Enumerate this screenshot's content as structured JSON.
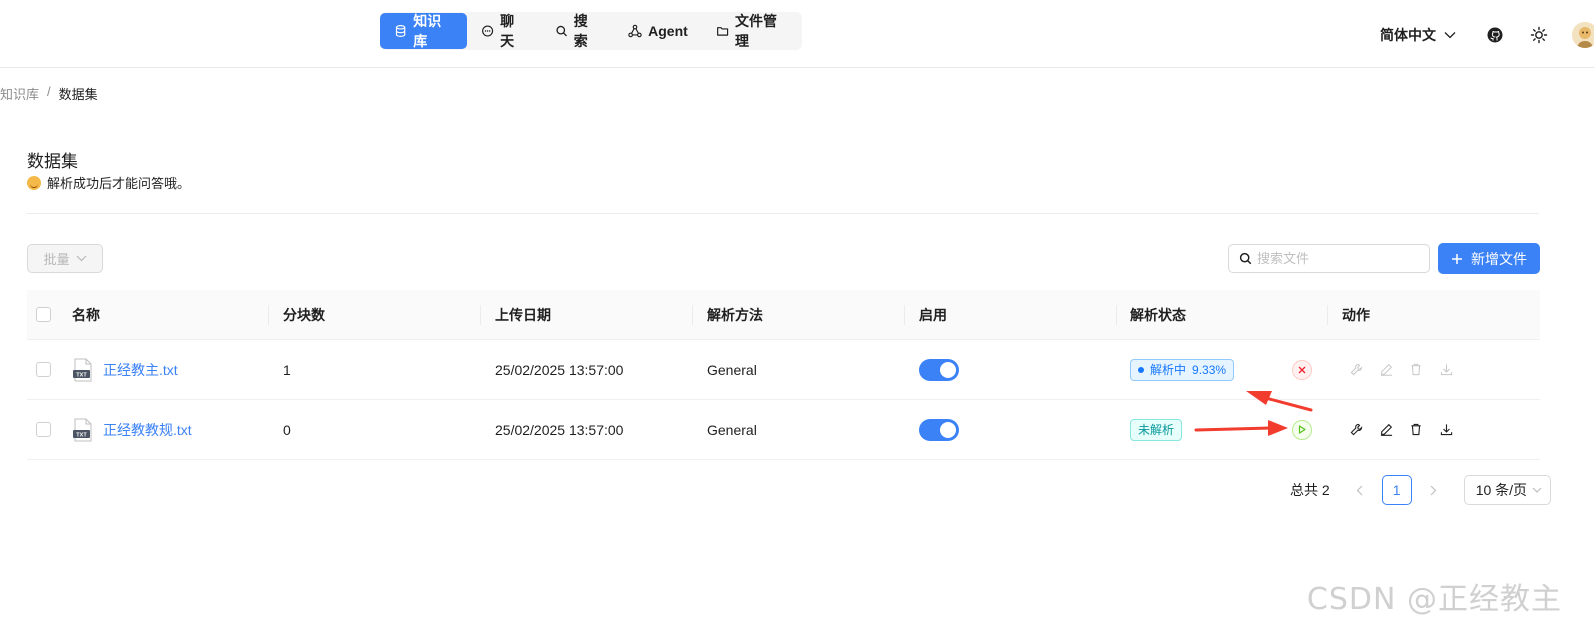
{
  "nav": {
    "items": [
      {
        "label": "知识库",
        "icon": "database-icon",
        "active": true
      },
      {
        "label": "聊天",
        "icon": "chat-icon"
      },
      {
        "label": "搜索",
        "icon": "search-icon"
      },
      {
        "label": "Agent",
        "icon": "agent-icon"
      },
      {
        "label": "文件管理",
        "icon": "folder-icon"
      }
    ],
    "language": "简体中文"
  },
  "breadcrumb": {
    "parent": "知识库",
    "separator": "/",
    "current": "数据集"
  },
  "page": {
    "title": "数据集",
    "subtitle": "解析成功后才能问答哦。"
  },
  "toolbar": {
    "batch_label": "批量",
    "search_placeholder": "搜索文件",
    "add_label": "新增文件"
  },
  "table": {
    "headers": {
      "name": "名称",
      "chunks": "分块数",
      "upload_date": "上传日期",
      "parse_method": "解析方法",
      "enabled": "启用",
      "parse_status": "解析状态",
      "actions": "动作"
    },
    "rows": [
      {
        "name": "正经教主.txt",
        "chunks": "1",
        "upload_date": "25/02/2025 13:57:00",
        "parse_method": "General",
        "enabled": true,
        "status_label": "解析中",
        "progress": "9.33%",
        "status": "parsing"
      },
      {
        "name": "正经教教规.txt",
        "chunks": "0",
        "upload_date": "25/02/2025 13:57:00",
        "parse_method": "General",
        "enabled": true,
        "status_label": "未解析",
        "status": "unparsed"
      }
    ]
  },
  "pagination": {
    "total_label": "总共 2",
    "current_page": "1",
    "page_size": "10 条/页"
  },
  "watermark": "CSDN @正经教主",
  "colors": {
    "primary": "#3b82f6",
    "annotation_arrow": "#f23d2e"
  }
}
